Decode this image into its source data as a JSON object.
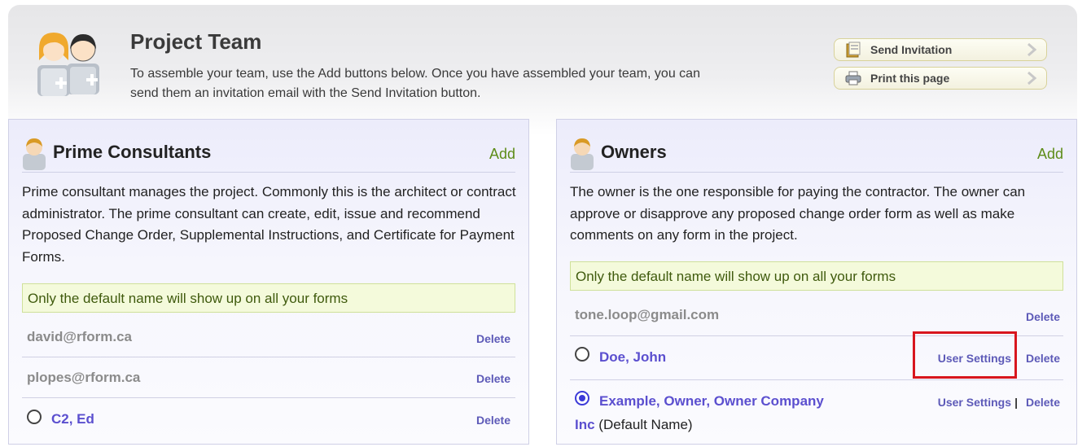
{
  "header": {
    "title": "Project Team",
    "description": "To assemble your team, use the Add buttons below. Once you have assembled your team, you can send them an invitation email with the Send Invitation button.",
    "send_invitation_label": "Send Invitation",
    "print_label": "Print this page"
  },
  "prime_consultants": {
    "title": "Prime Consultants",
    "add_label": "Add",
    "description": "Prime consultant manages the project. Commonly this is the architect or contract administrator. The prime consultant can create, edit, issue and recommend Proposed Change Order, Supplemental Instructions, and Certificate for Payment Forms.",
    "notice": "Only the default name will show up on all your forms",
    "members": [
      {
        "label": "david@rform.ca",
        "delete_label": "Delete"
      },
      {
        "label": "plopes@rform.ca",
        "delete_label": "Delete"
      },
      {
        "label": "C2, Ed",
        "delete_label": "Delete",
        "selected": false
      }
    ]
  },
  "owners": {
    "title": "Owners",
    "add_label": "Add",
    "description": "The owner is the one responsible for paying the contractor. The owner can approve or disapprove any proposed change order form as well as make comments on any form in the project.",
    "notice": "Only the default name will show up on all your forms",
    "members": [
      {
        "label": "tone.loop@gmail.com",
        "delete_label": "Delete"
      },
      {
        "label": "Doe, John",
        "settings_label": "User Settings",
        "delete_label": "Delete",
        "selected": false
      },
      {
        "label": "Example, Owner, Owner Company",
        "label_cont": "Inc",
        "default_note": "(Default Name)",
        "settings_label": "User Settings",
        "separator": "|",
        "delete_label": "Delete",
        "selected": true
      }
    ]
  },
  "colors": {
    "add_link": "#5d8c18",
    "action_link": "#5d5ab8",
    "member_name": "#5b4fcf",
    "highlight": "#d8161e"
  }
}
